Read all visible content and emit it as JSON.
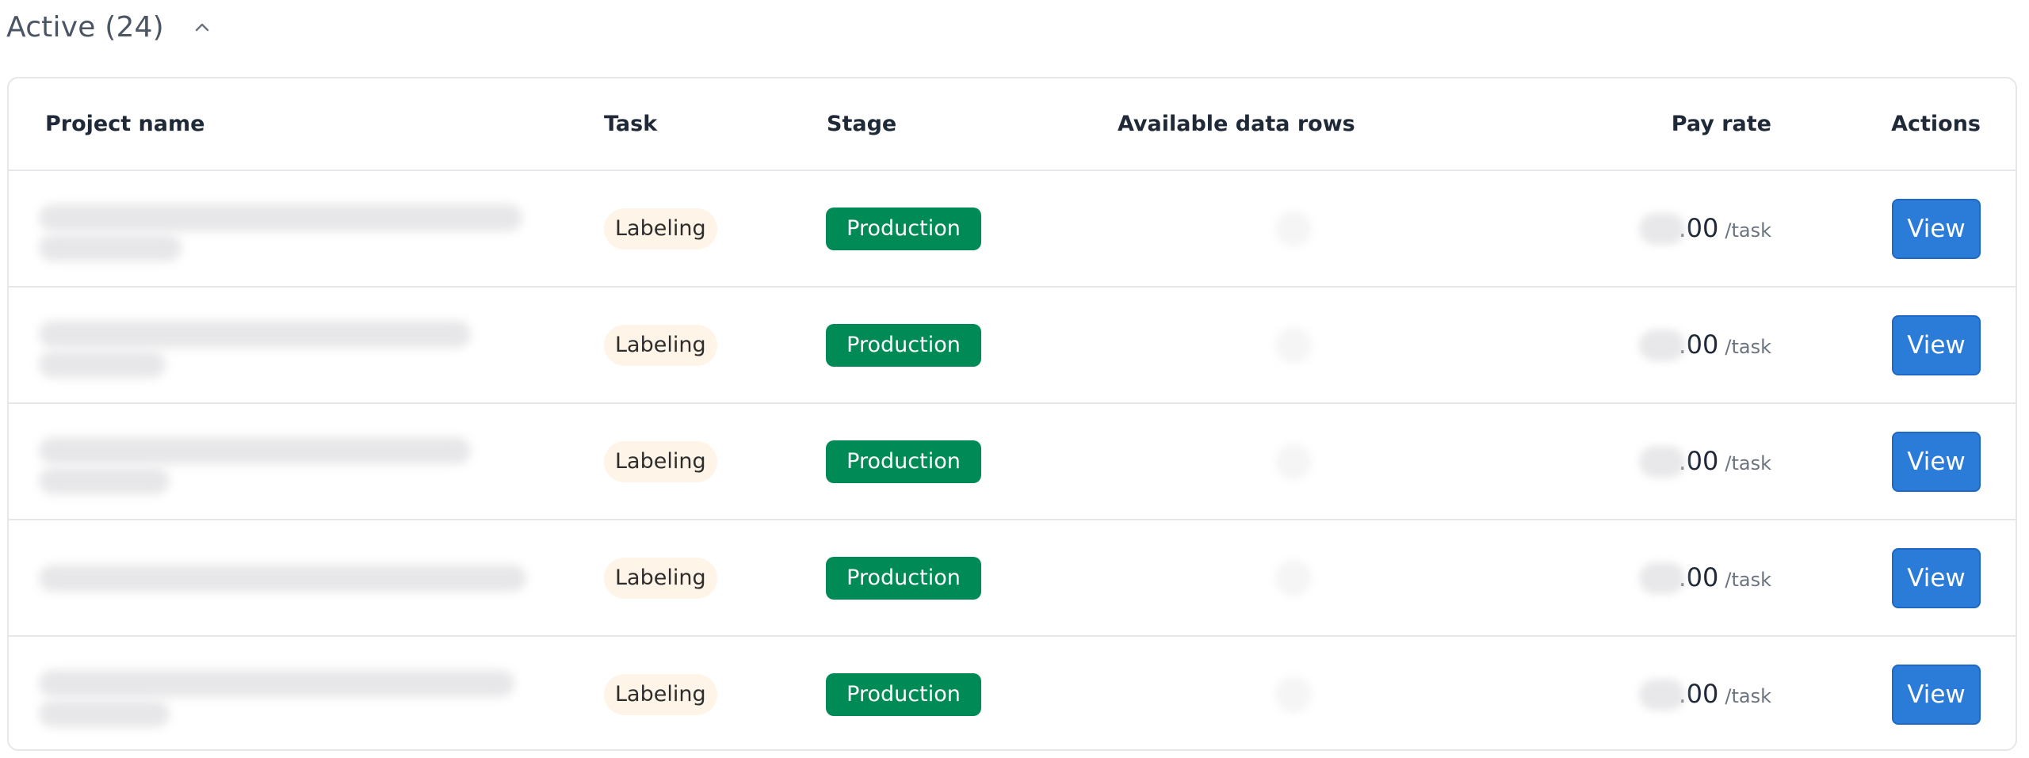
{
  "section": {
    "title": "Active (24)",
    "toggle_icon": "chevron-up-icon"
  },
  "table": {
    "headers": {
      "project_name": "Project name",
      "task": "Task",
      "stage": "Stage",
      "available_data_rows": "Available data rows",
      "pay_rate": "Pay rate",
      "actions": "Actions"
    },
    "rows": [
      {
        "project_name": "",
        "task": "Labeling",
        "stage": "Production",
        "available_data_rows": "",
        "pay_amount": ".00",
        "pay_unit": "/task",
        "action": "View"
      },
      {
        "project_name": "",
        "task": "Labeling",
        "stage": "Production",
        "available_data_rows": "",
        "pay_amount": ".00",
        "pay_unit": "/task",
        "action": "View"
      },
      {
        "project_name": "",
        "task": "Labeling",
        "stage": "Production",
        "available_data_rows": "",
        "pay_amount": ".00",
        "pay_unit": "/task",
        "action": "View"
      },
      {
        "project_name": "",
        "task": "Labeling",
        "stage": "Production",
        "available_data_rows": "",
        "pay_amount": ".00",
        "pay_unit": "/task",
        "action": "View"
      },
      {
        "project_name": "",
        "task": "Labeling",
        "stage": "Production",
        "available_data_rows": "",
        "pay_amount": ".00",
        "pay_unit": "/task",
        "action": "View"
      }
    ]
  },
  "colors": {
    "stage_badge": "#008a55",
    "task_pill_bg": "#fff4e8",
    "view_button": "#2b7bd9",
    "border": "#e5e7eb"
  }
}
